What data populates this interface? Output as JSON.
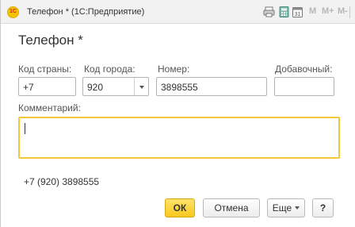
{
  "window": {
    "title": "Телефон * (1С:Предприятие)",
    "logo_text": "1С",
    "toolbar": {
      "icons": [
        "printer-icon",
        "calculator-icon",
        "calendar-icon"
      ],
      "calendar_label": "31",
      "memory_buttons": [
        "M",
        "M+",
        "M-"
      ]
    }
  },
  "form": {
    "heading": "Телефон *",
    "fields": {
      "country": {
        "label": "Код страны:",
        "value": "+7"
      },
      "city": {
        "label": "Код города:",
        "value": "920"
      },
      "number": {
        "label": "Номер:",
        "value": "3898555"
      },
      "extension": {
        "label": "Добавочный:",
        "value": ""
      }
    },
    "comment": {
      "label": "Комментарий:",
      "value": ""
    },
    "summary": "+7 (920) 3898555"
  },
  "buttons": {
    "ok": "ОК",
    "cancel": "Отмена",
    "more": "Еще",
    "help": "?"
  },
  "colors": {
    "accent": "#f8c81f",
    "focus_border": "#f5c73a",
    "logo_text": "#d6261c"
  }
}
